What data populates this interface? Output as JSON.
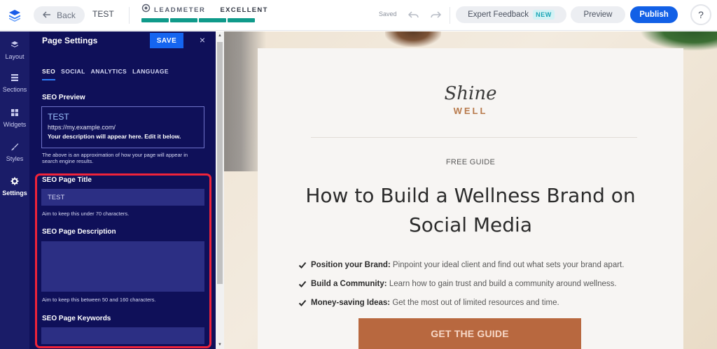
{
  "topbar": {
    "back_label": "Back",
    "page_name": "TEST",
    "leadmeter_label": "LEADMETER",
    "leadmeter_score": "EXCELLENT",
    "leadmeter_fill": 1.0,
    "saved_label": "Saved",
    "expert_feedback_label": "Expert Feedback",
    "new_badge": "NEW",
    "preview_label": "Preview",
    "publish_label": "Publish",
    "help_label": "?",
    "accent_color": "#1260e6",
    "meter_color": "#0f9a8a"
  },
  "leftnav": {
    "items": [
      {
        "label": "Layout",
        "icon": "layers-icon"
      },
      {
        "label": "Sections",
        "icon": "sections-icon"
      },
      {
        "label": "Widgets",
        "icon": "widgets-icon"
      },
      {
        "label": "Styles",
        "icon": "brush-icon"
      },
      {
        "label": "Settings",
        "icon": "gear-icon",
        "active": true
      }
    ]
  },
  "panel": {
    "title": "Page Settings",
    "save_label": "SAVE",
    "close_label": "×",
    "tabs": [
      {
        "label": "SEO",
        "active": true
      },
      {
        "label": "SOCIAL"
      },
      {
        "label": "ANALYTICS"
      },
      {
        "label": "LANGUAGE"
      }
    ],
    "seo_preview": {
      "label": "SEO Preview",
      "title": "TEST",
      "url": "https://my.example.com/",
      "description": "Your description will appear here. Edit it below.",
      "hint": "The above is an approximation of how your page will appear in search engine results."
    },
    "seo_title": {
      "label": "SEO Page Title",
      "value": "TEST",
      "hint": "Aim to keep this under 70 characters."
    },
    "seo_description": {
      "label": "SEO Page Description",
      "value": "",
      "hint": "Aim to keep this between 50 and 160 characters."
    },
    "seo_keywords": {
      "label": "SEO Page Keywords",
      "value": ""
    },
    "highlight_color": "#f0233a"
  },
  "canvas": {
    "brand_script": "Shine",
    "brand_sub": "WELL",
    "eyebrow": "FREE GUIDE",
    "headline_line1": "How to Build a Wellness Brand on",
    "headline_line2": "Social Media",
    "bullets": [
      {
        "bold": "Position your Brand:",
        "text": " Pinpoint your ideal client and find out what sets your brand apart."
      },
      {
        "bold": "Build a Community:",
        "text": " Learn how to gain trust and build a community around wellness."
      },
      {
        "bold": "Money-saving Ideas:",
        "text": " Get the most out of limited resources and time."
      }
    ],
    "cta_label": "GET THE GUIDE",
    "cta_color": "#b8683f"
  }
}
